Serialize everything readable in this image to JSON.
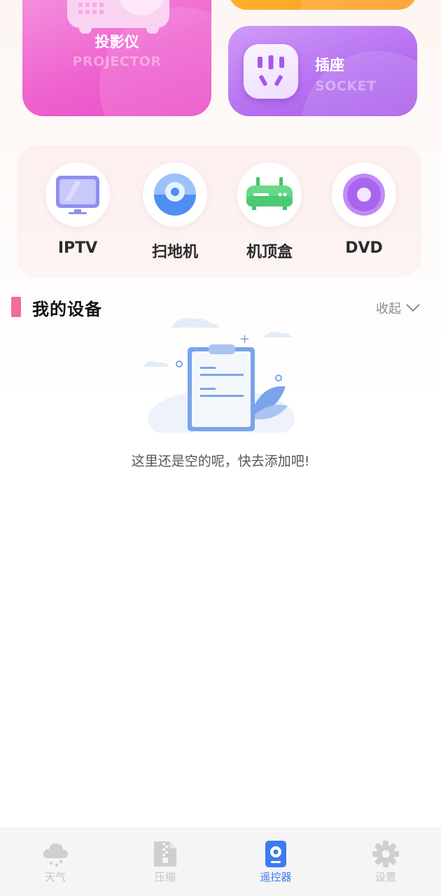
{
  "categories": {
    "projector": {
      "title": "投影仪",
      "subtitle": "PROJECTOR"
    },
    "socket": {
      "title": "插座",
      "subtitle": "SOCKET"
    }
  },
  "devices": [
    {
      "label": "IPTV",
      "icon": "tv-icon"
    },
    {
      "label": "扫地机",
      "icon": "robot-vacuum-icon"
    },
    {
      "label": "机顶盒",
      "icon": "set-top-box-icon"
    },
    {
      "label": "DVD",
      "icon": "disc-icon"
    }
  ],
  "my_devices": {
    "title": "我的设备",
    "collapse_label": "收起",
    "empty_text": "这里还是空的呢，快去添加吧!"
  },
  "nav": {
    "items": [
      {
        "label": "天气",
        "icon": "cloud-icon"
      },
      {
        "label": "压缩",
        "icon": "zip-file-icon"
      },
      {
        "label": "遥控器",
        "icon": "remote-icon"
      },
      {
        "label": "设置",
        "icon": "gear-icon"
      }
    ],
    "active_index": 2
  },
  "colors": {
    "projector": "#ee62cf",
    "socket": "#b56ef0",
    "orange": "#ff9b20",
    "section_accent": "#f26c97",
    "nav_active": "#3c7cf0",
    "nav_inactive": "#c4c4c4"
  }
}
